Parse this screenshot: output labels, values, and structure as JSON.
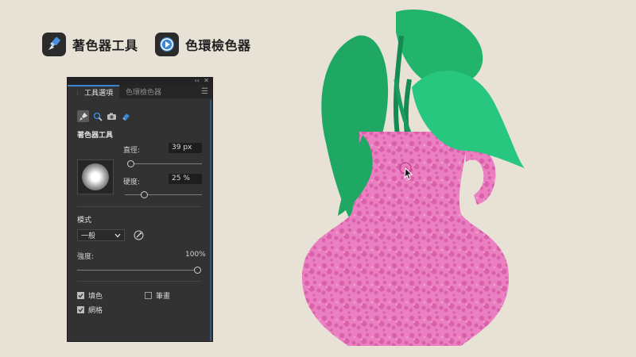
{
  "legend": [
    {
      "label": "著色器工具",
      "icon": "brush-icon"
    },
    {
      "label": "色環檢色器",
      "icon": "play-circle-icon"
    }
  ],
  "panel": {
    "window_controls": {
      "collapse": "‹‹",
      "close": "✕"
    },
    "tabs": [
      {
        "label": "工具選項",
        "active": true
      },
      {
        "label": "色環檢色器",
        "active": false
      }
    ],
    "tools": [
      {
        "icon": "brush-icon",
        "active": true
      },
      {
        "icon": "magnifier-icon",
        "active": false
      },
      {
        "icon": "camera-icon",
        "active": false
      },
      {
        "icon": "eraser-icon",
        "active": false
      }
    ],
    "section_title": "著色器工具",
    "diameter": {
      "label": "直徑:",
      "value": "39 px",
      "level": 0.0
    },
    "hardness": {
      "label": "硬度:",
      "value": "25 %",
      "level": 0.25
    },
    "mode": {
      "label": "模式",
      "value": "一般"
    },
    "strength": {
      "label": "強度:",
      "value": "100%",
      "level": 1.0
    },
    "checks": [
      {
        "label": "填色",
        "checked": true
      },
      {
        "label": "筆畫",
        "checked": false
      },
      {
        "label": "網格",
        "checked": true
      }
    ]
  },
  "colors": {
    "background": "#e7e1d6",
    "panel": "#323232",
    "accent": "#3a86d4",
    "vase_pink": "#e87bbf",
    "vase_dots": "#d85aa6",
    "leaf_dark": "#1f9e60",
    "leaf_light": "#27c77f"
  }
}
